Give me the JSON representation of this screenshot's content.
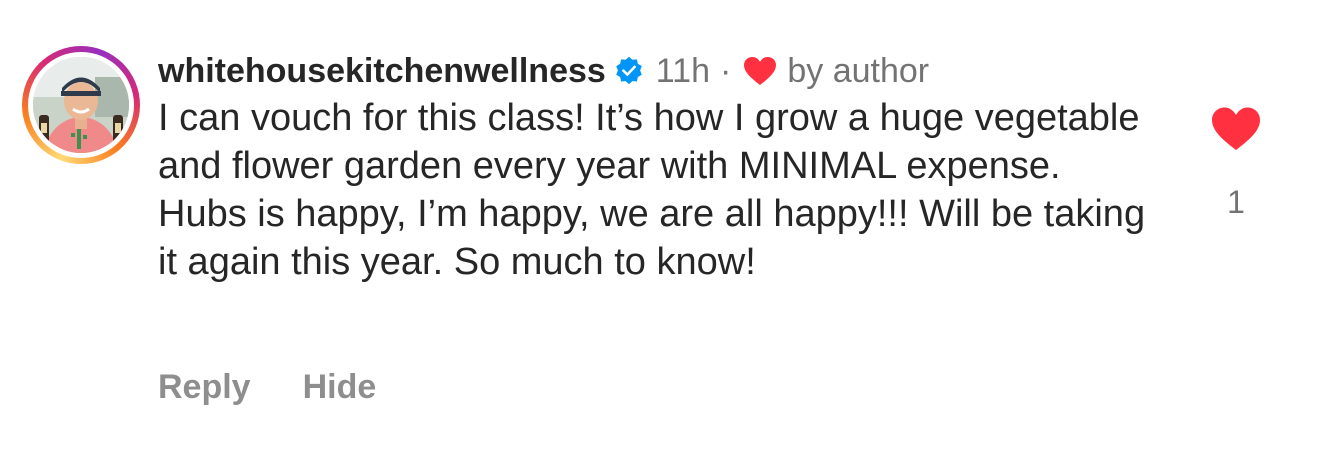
{
  "comment": {
    "username": "whitehousekitchenwellness",
    "verified_icon": "verified-badge-icon",
    "time": "11h",
    "separator": "·",
    "author_like_icon": "heart-icon",
    "author_like_label": "by author",
    "text": "I can vouch for this class! It’s how I grow a huge vegetable and flower garden every year with MINIMAL expense. Hubs is happy, I’m happy, we are all happy!!! Will be taking it again this year. So much to know!",
    "actions": {
      "reply_label": "Reply",
      "hide_label": "Hide"
    },
    "like_icon": "heart-icon",
    "like_count": "1"
  },
  "colors": {
    "text": "#262626",
    "secondary": "#737373",
    "action": "#8e8e8e",
    "heart": "#ff3040",
    "verified": "#0095f6"
  }
}
